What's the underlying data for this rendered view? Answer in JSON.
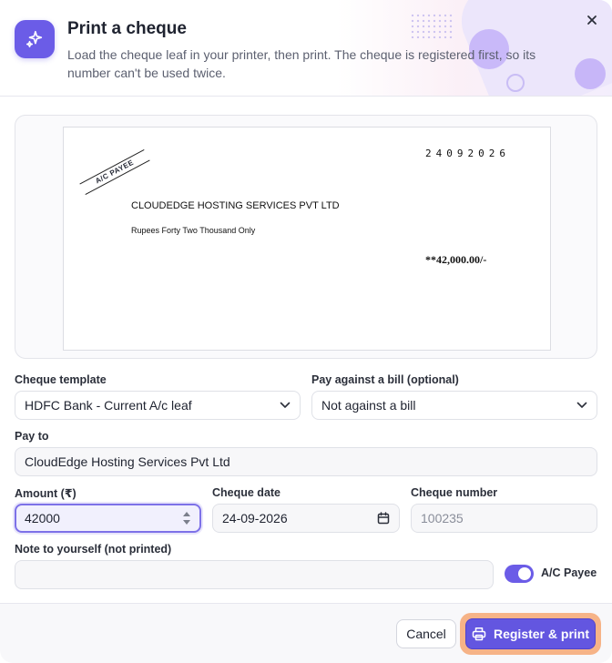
{
  "dialog": {
    "title": "Print a cheque",
    "subtitle": "Load the cheque leaf in your printer, then print. The cheque is registered first, so its number can't be used twice.",
    "accent_color": "#6b5ce7"
  },
  "cheque_preview": {
    "crossing": "A/C PAYEE",
    "date": "24092026",
    "payee": "CLOUDEDGE HOSTING SERVICES PVT LTD",
    "amount_words": "Rupees Forty Two Thousand Only",
    "amount_figures": "**42,000.00/-"
  },
  "form": {
    "template": {
      "label": "Cheque template",
      "value": "HDFC Bank - Current A/c leaf"
    },
    "bill": {
      "label": "Pay against a bill (optional)",
      "value": "Not against a bill"
    },
    "pay_to": {
      "label": "Pay to",
      "value": "CloudEdge Hosting Services Pvt Ltd"
    },
    "amount": {
      "label": "Amount (₹)",
      "value": "42000"
    },
    "cheque_date": {
      "label": "Cheque date",
      "value": "24-09-2026"
    },
    "cheque_number": {
      "label": "Cheque number",
      "value": "100235"
    },
    "note": {
      "label": "Note to yourself (not printed)",
      "value": ""
    },
    "ac_payee_toggle": {
      "label": "A/C Payee",
      "checked": true
    }
  },
  "footer": {
    "cancel_label": "Cancel",
    "primary_label": "Register & print"
  },
  "icons": [
    "sparkle-icon",
    "close-icon",
    "chevron-down-icon",
    "stepper-icon",
    "calendar-icon",
    "printer-icon"
  ]
}
